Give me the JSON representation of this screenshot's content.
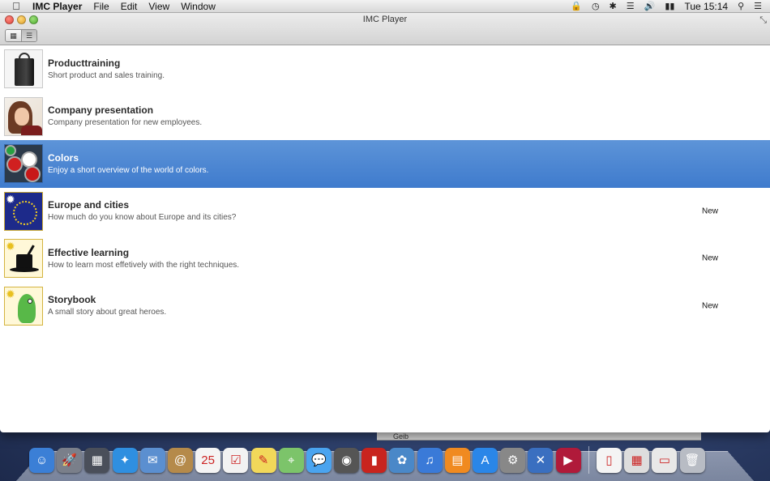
{
  "menubar": {
    "app_name": "IMC Player",
    "menus": [
      "File",
      "Edit",
      "View",
      "Window"
    ],
    "clock": "Tue 15:14",
    "status_icons": [
      "lock-icon",
      "time-machine-icon",
      "bluetooth-icon",
      "wifi-icon",
      "volume-icon",
      "battery-icon",
      "spotlight-icon",
      "notification-center-icon"
    ]
  },
  "window": {
    "title": "IMC Player",
    "view_modes": [
      "grid",
      "list"
    ],
    "selected_view": "list"
  },
  "items": [
    {
      "title": "Producttraining",
      "description": "Short product and sales training.",
      "badge": "",
      "thumb": "shopping-bag"
    },
    {
      "title": "Company presentation",
      "description": "Company presentation for new employees.",
      "badge": "",
      "thumb": "woman"
    },
    {
      "title": "Colors",
      "description": "Enjoy a short overview of the world of colors.",
      "badge": "",
      "thumb": "paint-cans",
      "selected": true
    },
    {
      "title": "Europe and cities",
      "description": "How much do you know about Europe and its cities?",
      "badge": "New",
      "thumb": "eu-flag"
    },
    {
      "title": "Effective learning",
      "description": "How to learn most effetively with the right techniques.",
      "badge": "New",
      "thumb": "magic-hat"
    },
    {
      "title": "Storybook",
      "description": "A small story about great heroes.",
      "badge": "New",
      "thumb": "dragon"
    }
  ],
  "background_window": {
    "label": "Geib"
  },
  "dock": {
    "apps": [
      {
        "name": "finder",
        "glyph": "☺",
        "color": "#3b7fd6"
      },
      {
        "name": "launchpad",
        "glyph": "🚀",
        "color": "#7a7f8a"
      },
      {
        "name": "mission-control",
        "glyph": "▦",
        "color": "#4a4f5a"
      },
      {
        "name": "safari",
        "glyph": "✦",
        "color": "#2f8fe0"
      },
      {
        "name": "mail",
        "glyph": "✉",
        "color": "#5b8fd0"
      },
      {
        "name": "contacts",
        "glyph": "@",
        "color": "#b58a4a"
      },
      {
        "name": "calendar",
        "glyph": "25",
        "color": "#f4f4f4"
      },
      {
        "name": "reminders",
        "glyph": "☑",
        "color": "#f2f2f2"
      },
      {
        "name": "notes",
        "glyph": "✎",
        "color": "#f1d85a"
      },
      {
        "name": "maps",
        "glyph": "⌖",
        "color": "#7cc46a"
      },
      {
        "name": "messages",
        "glyph": "💬",
        "color": "#4aa4ef"
      },
      {
        "name": "facetime",
        "glyph": "◉",
        "color": "#555"
      },
      {
        "name": "photo-booth",
        "glyph": "▮",
        "color": "#c8241e"
      },
      {
        "name": "iphoto",
        "glyph": "✿",
        "color": "#4a88c8"
      },
      {
        "name": "itunes",
        "glyph": "♫",
        "color": "#3a7ad8"
      },
      {
        "name": "ibooks",
        "glyph": "▤",
        "color": "#f08a20"
      },
      {
        "name": "app-store",
        "glyph": "A",
        "color": "#2a86e8"
      },
      {
        "name": "system-preferences",
        "glyph": "⚙",
        "color": "#888"
      },
      {
        "name": "xcode",
        "glyph": "✕",
        "color": "#3a6fc0"
      },
      {
        "name": "imc-player",
        "glyph": "▶",
        "color": "#b01a3a"
      }
    ],
    "others": [
      {
        "name": "document",
        "glyph": "▯",
        "color": "#f4f4f4"
      },
      {
        "name": "downloads-stack",
        "glyph": "▦",
        "color": "#ddd"
      },
      {
        "name": "preview-stack",
        "glyph": "▭",
        "color": "#e8e8e8"
      },
      {
        "name": "trash",
        "glyph": "🗑",
        "color": "#b8bcc4"
      }
    ]
  }
}
